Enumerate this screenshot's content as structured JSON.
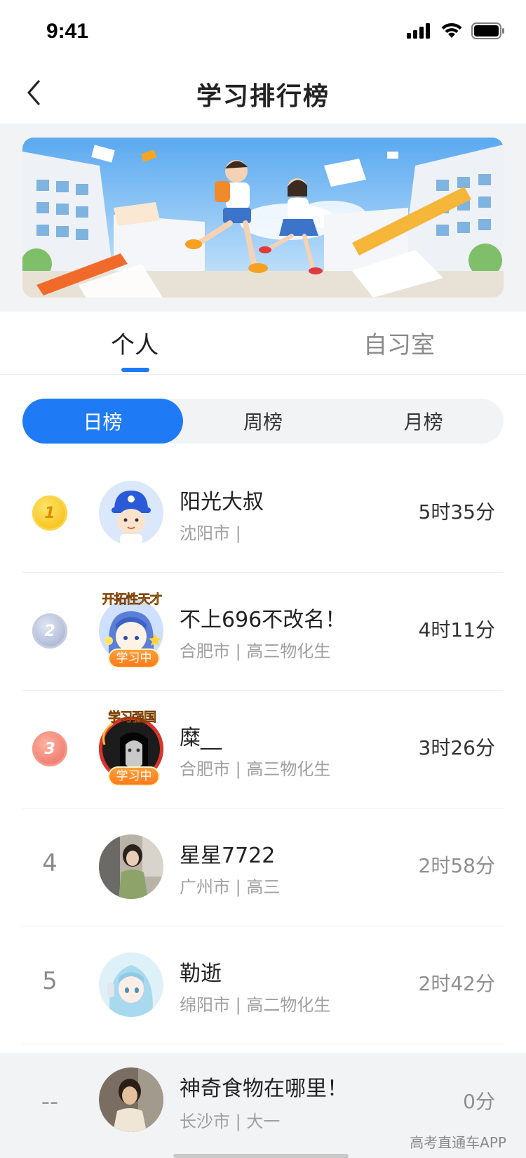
{
  "status_bar": {
    "time": "9:41"
  },
  "nav": {
    "title": "学习排行榜"
  },
  "tabs": [
    {
      "label": "个人",
      "active": true
    },
    {
      "label": "自习室",
      "active": false
    }
  ],
  "period_tabs": [
    {
      "label": "日榜",
      "active": true
    },
    {
      "label": "周榜",
      "active": false
    },
    {
      "label": "月榜",
      "active": false
    }
  ],
  "ranking": [
    {
      "rank": "1",
      "medal": "gold",
      "name": "阳光大叔",
      "meta": "沈阳市 |",
      "time": "5时35分"
    },
    {
      "rank": "2",
      "medal": "silver",
      "name": "不上696不改名！",
      "meta": "合肥市 | 高三物化生",
      "time": "4时11分",
      "frame_text": "开拓性天才",
      "badge": "学习中"
    },
    {
      "rank": "3",
      "medal": "bronze",
      "name": "糜__",
      "meta": "合肥市 | 高三物化生",
      "time": "3时26分",
      "frame_text": "学习强国",
      "badge": "学习中"
    },
    {
      "rank": "4",
      "name": "星星7722",
      "meta": "广州市 | 高三",
      "time": "2时58分"
    },
    {
      "rank": "5",
      "name": "勒逝",
      "meta": "绵阳市 | 高二物化生",
      "time": "2时42分"
    }
  ],
  "self": {
    "rank": "--",
    "name": "神奇食物在哪里！",
    "meta": "长沙市 | 大一",
    "time": "0分"
  },
  "watermark": "高考直通车APP",
  "colors": {
    "accent": "#1e7bf5",
    "gold": "#f5b400",
    "silver": "#9aa7c8",
    "bronze": "#e8685a"
  }
}
